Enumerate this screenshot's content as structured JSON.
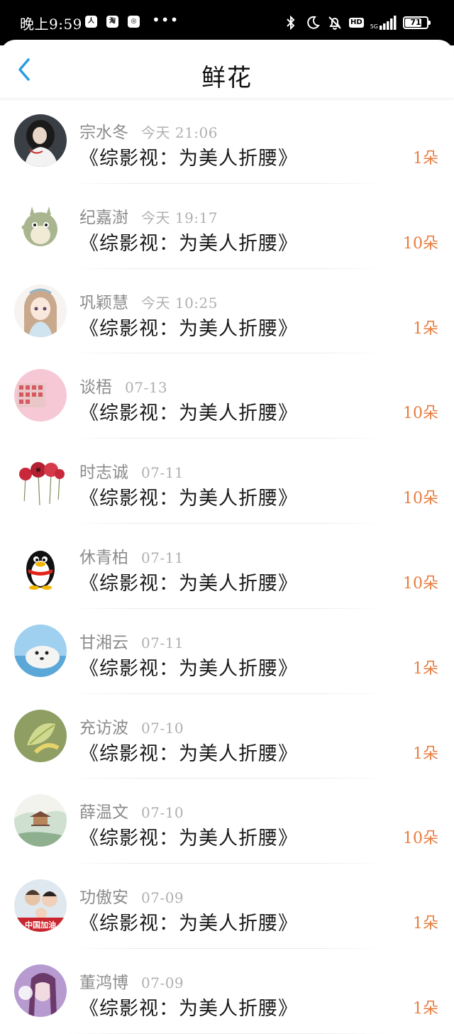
{
  "status_bar": {
    "time": "晚上9:59",
    "apps": [
      "人",
      "淘",
      "◎"
    ],
    "more": "•••",
    "network_label": "5G",
    "battery": "71",
    "battery_level": 0.71
  },
  "header": {
    "title": "鲜花",
    "back_icon": "chevron-left-icon",
    "accent_color": "#2a9de0"
  },
  "count_color": "#e87c3e",
  "items": [
    {
      "name": "宗水冬",
      "time": "今天 21:06",
      "book": "《综影视：为美人折腰》",
      "count": "1朵",
      "avatar": "avatar-dark-hair-woman"
    },
    {
      "name": "纪嘉澍",
      "time": "今天 19:17",
      "book": "《综影视：为美人折腰》",
      "count": "10朵",
      "avatar": "avatar-totoro"
    },
    {
      "name": "巩颖慧",
      "time": "今天 10:25",
      "book": "《综影视：为美人折腰》",
      "count": "1朵",
      "avatar": "avatar-anime-girl"
    },
    {
      "name": "谈梧",
      "time": "07-13",
      "book": "《综影视：为美人折腰》",
      "count": "10朵",
      "avatar": "avatar-pink-photo"
    },
    {
      "name": "时志诚",
      "time": "07-11",
      "book": "《综影视：为美人折腰》",
      "count": "10朵",
      "avatar": "avatar-red-flowers"
    },
    {
      "name": "休青柏",
      "time": "07-11",
      "book": "《综影视：为美人折腰》",
      "count": "10朵",
      "avatar": "avatar-penguin"
    },
    {
      "name": "甘湘云",
      "time": "07-11",
      "book": "《综影视：为美人折腰》",
      "count": "1朵",
      "avatar": "avatar-seal"
    },
    {
      "name": "充访波",
      "time": "07-10",
      "book": "《综影视：为美人折腰》",
      "count": "1朵",
      "avatar": "avatar-green-leaf"
    },
    {
      "name": "薛温文",
      "time": "07-10",
      "book": "《综影视：为美人折腰》",
      "count": "10朵",
      "avatar": "avatar-pavilion-painting"
    },
    {
      "name": "功傲安",
      "time": "07-09",
      "book": "《综影视：为美人折腰》",
      "count": "1朵",
      "avatar": "avatar-family-photo",
      "avatar_caption": "中国加油"
    },
    {
      "name": "董鸿博",
      "time": "07-09",
      "book": "《综影视：为美人折腰》",
      "count": "1朵",
      "avatar": "avatar-purple-portrait"
    }
  ]
}
